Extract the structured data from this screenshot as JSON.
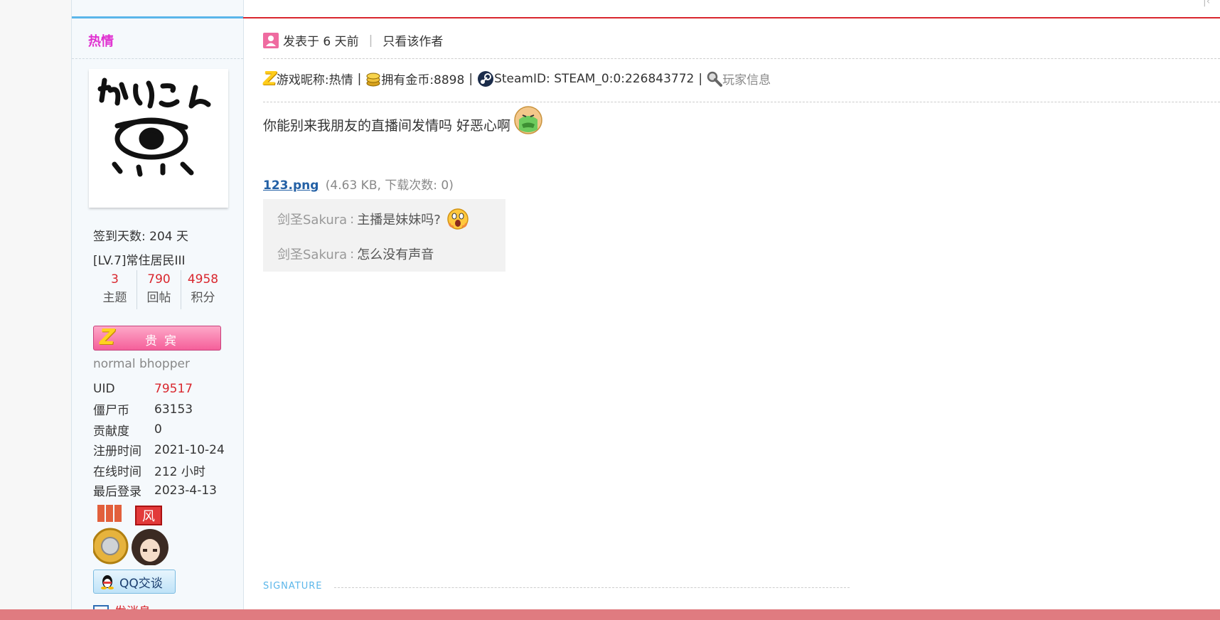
{
  "sidebar": {
    "username": "热情",
    "checkin": "签到天数: 204 天",
    "level": "[LV.7]常住居民III",
    "stats": [
      {
        "value": "3",
        "label": "主题"
      },
      {
        "value": "790",
        "label": "回帖"
      },
      {
        "value": "4958",
        "label": "积分"
      }
    ],
    "vip_label": "贵宾",
    "user_title": "normal bhopper",
    "info": [
      {
        "key": "UID",
        "value": "79517"
      },
      {
        "key": "僵尸币",
        "value": "63153"
      },
      {
        "key": "贡献度",
        "value": "0"
      },
      {
        "key": "注册时间",
        "value": "2021-10-24"
      },
      {
        "key": "在线时间",
        "value": "212 小时"
      },
      {
        "key": "最后登录",
        "value": "2023-4-13"
      }
    ],
    "qq_label": "QQ交谈",
    "pm_label": "发消息"
  },
  "post": {
    "posted": "发表于 6 天前",
    "only_author": "只看该作者",
    "profile": {
      "nickname": "游戏昵称:热情",
      "gold": "拥有金币:8898",
      "steamid": "SteamID: STEAM_0:0:226843772",
      "player_info": "玩家信息"
    },
    "message": "你能别来我朋友的直播间发情吗 好恶心啊",
    "attachment": {
      "name": "123.png",
      "meta": "(4.63 KB, 下载次数: 0)"
    },
    "comments": [
      {
        "author": "剑圣Sakura",
        "text": "主播是妹妹吗?"
      },
      {
        "author": "剑圣Sakura",
        "text": "怎么没有声音"
      }
    ],
    "signature": "SIGNATURE"
  },
  "colors": {
    "accent_red": "#d9272e",
    "accent_blue": "#5bb6ea",
    "username_pink": "#e030d0",
    "bottom_bar": "#e07b80"
  },
  "icons": [
    "user-icon",
    "z-icon",
    "coin-icon",
    "steam-icon",
    "magnifier-icon",
    "sick-emoji-icon",
    "shocked-emoji-icon",
    "qq-penguin-icon",
    "envelope-icon"
  ]
}
